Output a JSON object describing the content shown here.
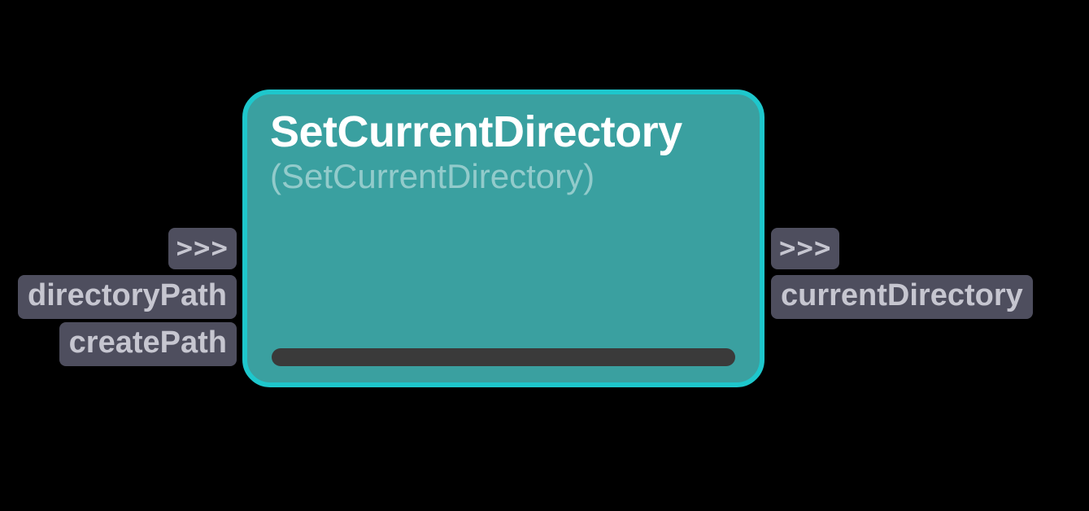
{
  "node": {
    "title": "SetCurrentDirectory",
    "subtitle": "(SetCurrentDirectory)"
  },
  "inputs": {
    "exec": ">>>",
    "ports": [
      "directoryPath",
      "createPath"
    ]
  },
  "outputs": {
    "exec": ">>>",
    "ports": [
      "currentDirectory"
    ]
  }
}
